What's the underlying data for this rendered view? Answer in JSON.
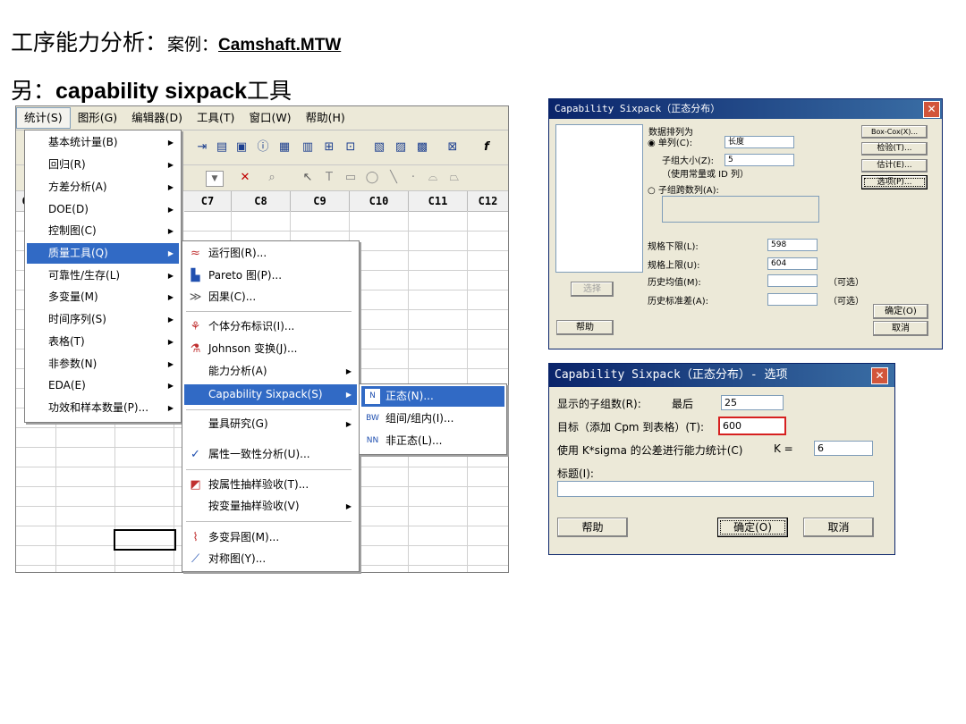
{
  "slide": {
    "heading": "工序能力分析：",
    "case_label": "案例：",
    "case_file": "Camshaft.MTW",
    "subheading_prefix": "另：",
    "subheading_en": "capability sixpack",
    "subheading_suffix": "工具"
  },
  "menubar": [
    "统计(S)",
    "图形(G)",
    "编辑器(D)",
    "工具(T)",
    "窗口(W)",
    "帮助(H)"
  ],
  "columns": [
    "C7",
    "C8",
    "C9",
    "C10",
    "C11",
    "C12"
  ],
  "stat_menu": [
    "基本统计量(B)",
    "回归(R)",
    "方差分析(A)",
    "DOE(D)",
    "控制图(C)",
    "质量工具(Q)",
    "可靠性/生存(L)",
    "多变量(M)",
    "时间序列(S)",
    "表格(T)",
    "非参数(N)",
    "EDA(E)",
    "功效和样本数量(P)..."
  ],
  "quality_menu": {
    "items": [
      "运行图(R)...",
      "Pareto 图(P)...",
      "因果(C)...",
      "个体分布标识(I)...",
      "Johnson 变换(J)...",
      "能力分析(A)",
      "Capability Sixpack(S)",
      "量具研究(G)",
      "属性一致性分析(U)...",
      "按属性抽样验收(T)...",
      "按变量抽样验收(V)",
      "多变异图(M)...",
      "对称图(Y)..."
    ]
  },
  "sixpack_menu": [
    "正态(N)...",
    "组间/组内(I)...",
    "非正态(L)..."
  ],
  "dialog1": {
    "title": "Capability Sixpack（正态分布）",
    "data_arranged_label": "数据排列为",
    "single_column_label": "单列(C):",
    "single_column_value": "长度",
    "subgroup_size_label": "子组大小(Z):",
    "subgroup_size_value": "5",
    "subgroup_hint": "（使用常量或 ID 列）",
    "subgroup_across_label": "子组跨数列(A):",
    "lsl_label": "规格下限(L):",
    "lsl_value": "598",
    "usl_label": "规格上限(U):",
    "usl_value": "604",
    "hist_mean_label": "历史均值(M):",
    "hist_sd_label": "历史标准差(A):",
    "optional": "（可选）",
    "select_button": "选择",
    "help_button": "帮助",
    "boxcox_button": "Box-Cox(X)...",
    "tests_button": "检验(T)...",
    "estimate_button": "估计(E)...",
    "options_button": "选项(P)...",
    "ok_button": "确定(O)",
    "cancel_button": "取消"
  },
  "dialog2": {
    "title": "Capability Sixpack（正态分布）- 选项",
    "display_subgroups_label": "显示的子组数(R):",
    "last_label": "最后",
    "last_value": "25",
    "target_label": "目标（添加 Cpm 到表格）(T):",
    "target_value": "600",
    "ksigma_label": "使用 K*sigma 的公差进行能力统计(C)",
    "k_label": "K =",
    "k_value": "6",
    "title_label": "标题(I):",
    "title_value": "",
    "help_button": "帮助",
    "ok_button": "确定(O)",
    "cancel_button": "取消",
    "highlight_color": "#d62020"
  }
}
